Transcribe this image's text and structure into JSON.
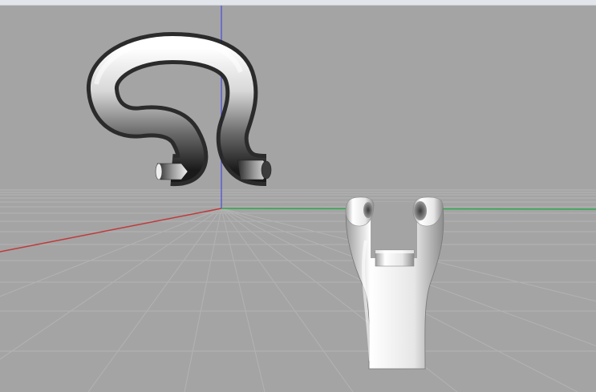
{
  "viewport": {
    "view": "perspective",
    "background_color": "#a4a4a4",
    "grid_color": "#b3b3b3",
    "axis_colors": {
      "x": "#c0393b",
      "y": "#2fa84f",
      "z": "#4a4adf"
    },
    "objects": [
      {
        "name": "bent-handle",
        "material": "glossy-white"
      },
      {
        "name": "clip-hook",
        "material": "glossy-white"
      }
    ]
  }
}
